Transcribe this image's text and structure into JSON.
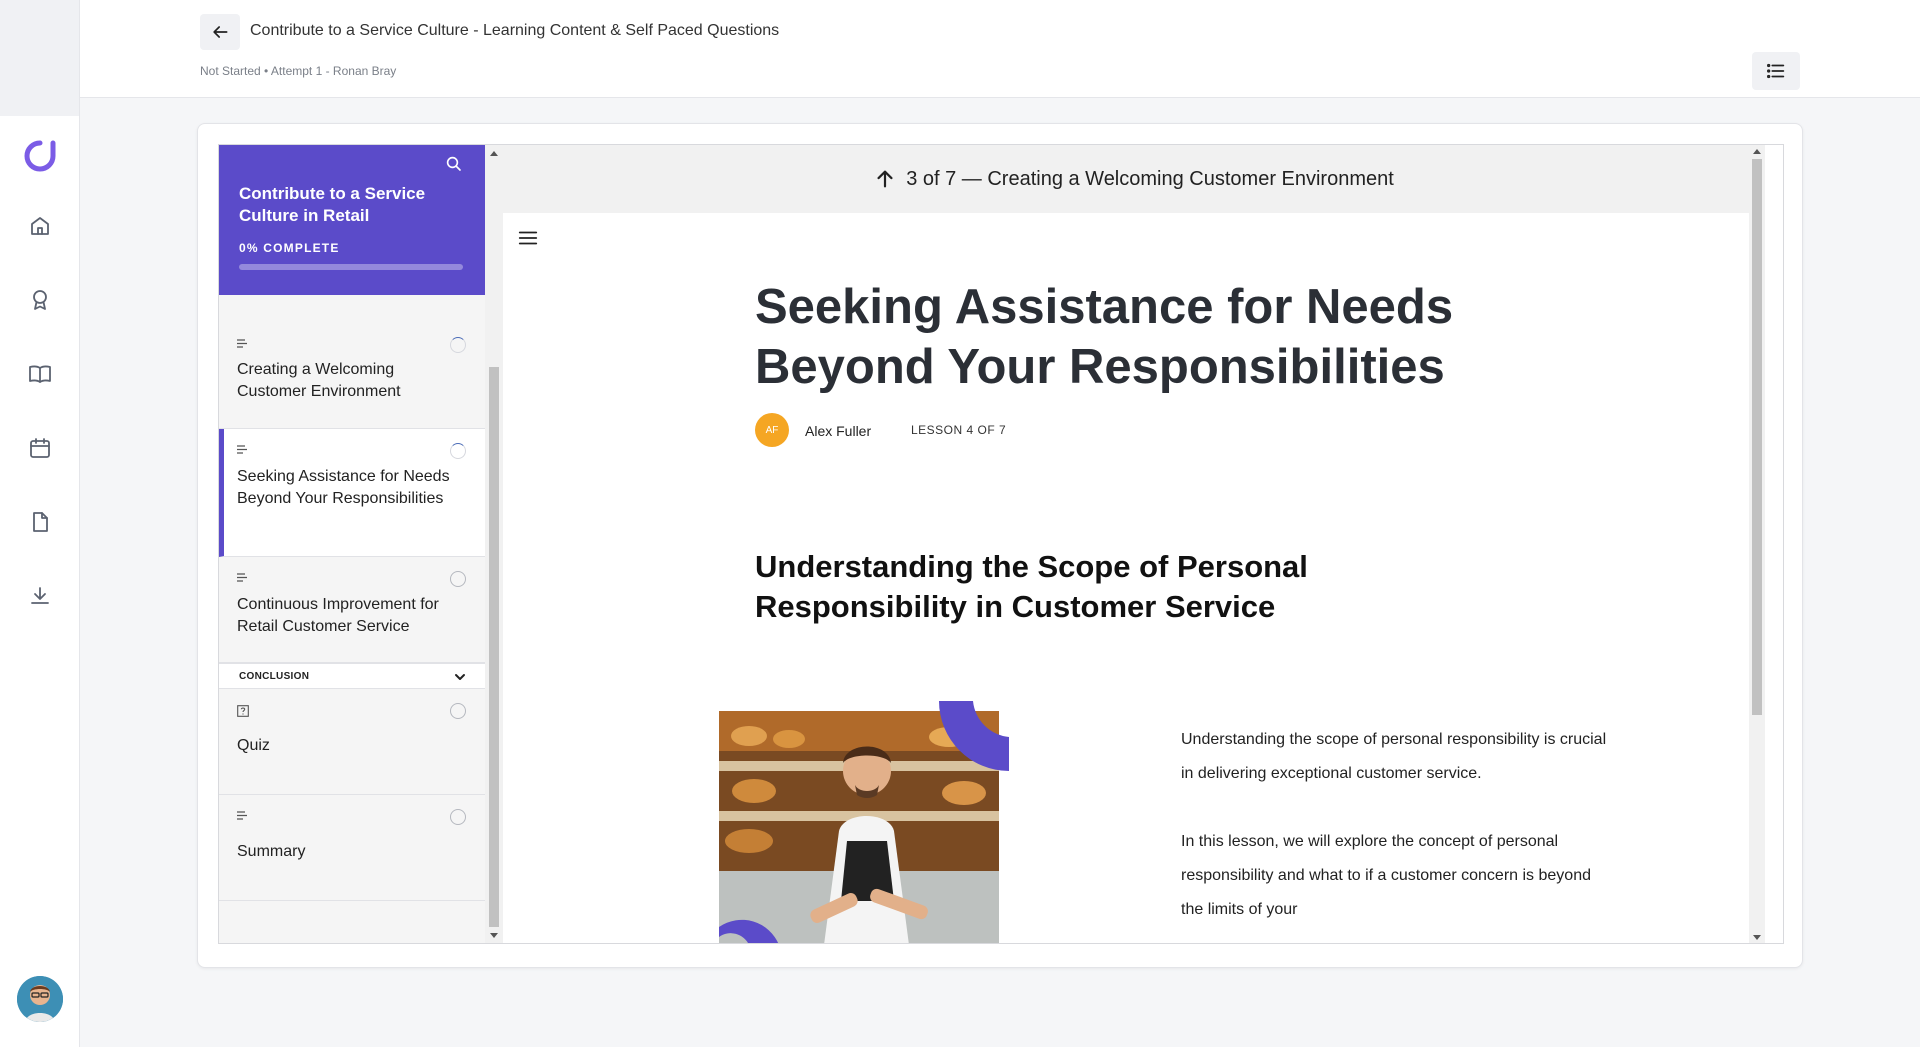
{
  "header": {
    "title": "Contribute to a Service Culture - Learning Content & Self Paced Questions",
    "meta": "Not Started • Attempt 1 - Ronan Bray"
  },
  "nav": {
    "items": [
      "home-icon",
      "award-icon",
      "book-icon",
      "calendar-icon",
      "file-icon",
      "download-icon"
    ]
  },
  "course": {
    "title": "Contribute to a Service Culture in Retail",
    "progress_label": "0% COMPLETE",
    "progress": 0
  },
  "sidebar": {
    "lessons": [
      {
        "label": "Creating a Welcoming Customer Environment"
      },
      {
        "label": "Seeking Assistance for Needs Beyond Your Responsibilities"
      },
      {
        "label": "Continuous Improvement for Retail Customer Service"
      }
    ],
    "section": {
      "label": "CONCLUSION"
    },
    "conclusion_items": [
      {
        "label": "Quiz"
      },
      {
        "label": "Summary"
      }
    ]
  },
  "content": {
    "top_nav": "3 of 7 — Creating a Welcoming Customer Environment",
    "title": "Seeking Assistance for Needs Beyond Your Responsibilities",
    "author_initials": "AF",
    "author": "Alex Fuller",
    "lesson_count": "LESSON 4 OF 7",
    "subheading": "Understanding the Scope of Personal Responsibility in Customer Service",
    "paragraphs": [
      "Understanding the scope of personal responsibility is crucial in delivering exceptional customer service.",
      "In this lesson, we will explore the concept of personal responsibility and what to if a customer concern is beyond the limits of your"
    ]
  },
  "colors": {
    "accent": "#5b4bc9",
    "author_badge": "#f5a623"
  }
}
